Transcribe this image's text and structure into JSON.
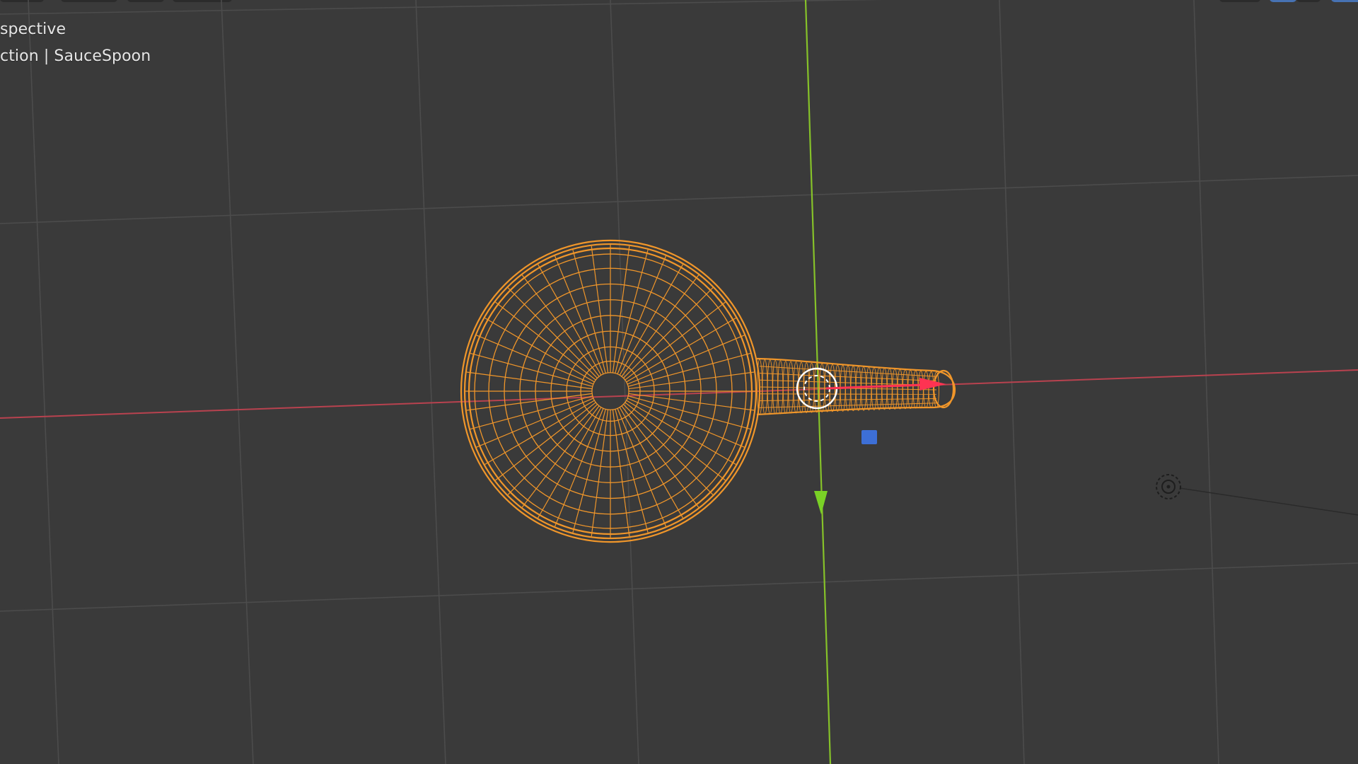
{
  "viewport": {
    "view_label": "spective",
    "object_label": "ction | SauceSpoon"
  },
  "colors": {
    "background": "#3a3a3a",
    "grid": "#4d4d4d",
    "x_axis": "#c6455a",
    "y_axis": "#8ac52b",
    "selected_wire": "#f0962a",
    "gizmo_x": "#ff3352",
    "gizmo_y": "#7ad126",
    "gizmo_z": "#3d6fd6"
  },
  "icons": {
    "origin": "object-origin-icon",
    "cursor": "3d-cursor-icon",
    "light": "light-object-icon"
  }
}
